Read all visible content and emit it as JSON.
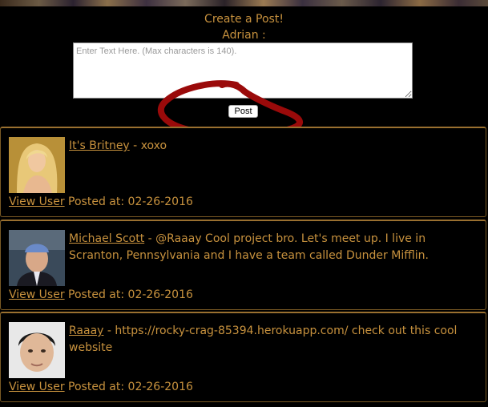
{
  "composer": {
    "title": "Create a Post!",
    "username": "Adrian :",
    "placeholder": "Enter Text Here. (Max characters is 140).",
    "post_label": "Post"
  },
  "posts": [
    {
      "author": "It's Britney",
      "separator": " - ",
      "message": "xoxo",
      "view_user": "View User",
      "posted_label": "Posted at: ",
      "date": "02-26-2016",
      "avatar_icon": "blonde-woman-avatar"
    },
    {
      "author": "Michael Scott",
      "separator": " - ",
      "message": "@Raaay Cool project bro. Let's meet up. I live in Scranton, Pennsylvania and I have a team called Dunder Mifflin.",
      "view_user": "View User",
      "posted_label": "Posted at: ",
      "date": "02-26-2016",
      "avatar_icon": "man-bandana-avatar"
    },
    {
      "author": "Raaay",
      "separator": " - ",
      "message": "https://rocky-crag-85394.herokuapp.com/ check out this cool website",
      "view_user": "View User",
      "posted_label": "Posted at: ",
      "date": "02-26-2016",
      "avatar_icon": "young-man-avatar"
    }
  ],
  "colors": {
    "background": "#000000",
    "accent": "#c8923e",
    "border": "#9a7030",
    "annotation": "#9a0a0a"
  }
}
